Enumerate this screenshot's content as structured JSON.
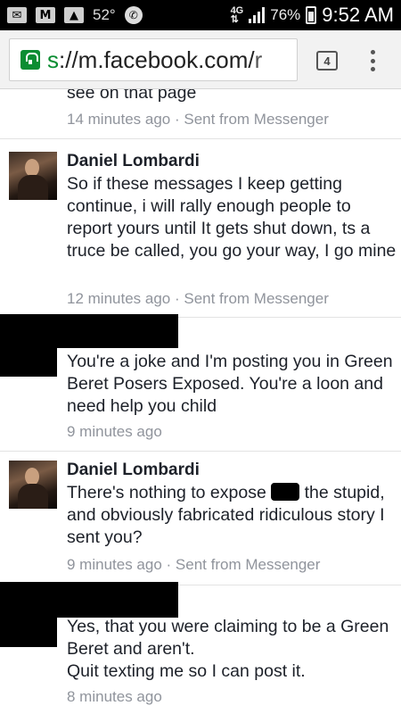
{
  "status_bar": {
    "icons": [
      "mail-icon",
      "gmail-icon",
      "gallery-icon"
    ],
    "temperature": "52°",
    "network": "4G LTE",
    "battery_percent": "76%",
    "battery_level": 0.76,
    "time": "9:52 AM"
  },
  "browser": {
    "url_scheme": "s",
    "url_main": "://m.facebook.com/",
    "url_tail": "r",
    "tab_count": "4"
  },
  "messages": [
    {
      "sender": "",
      "text": "see on that page",
      "time": "14 minutes ago",
      "source": "Sent from Messenger"
    },
    {
      "sender": "Daniel Lombardi",
      "text": "So if these messages I keep getting continue, i will rally enough people to report yours until It gets shut down, ts a truce be called, you go your way, I go mine",
      "time": "12 minutes ago",
      "source": "Sent from Messenger"
    },
    {
      "sender": "",
      "text": "You're a joke and I'm posting you in Green Beret Posers Exposed. You're a loon and need help you child",
      "time": "9 minutes ago",
      "source": ""
    },
    {
      "sender": "Daniel Lombardi",
      "text_before": "There's nothing to expose",
      "text_after": "the stupid, and obviously fabricated ridiculous story I sent you?",
      "time": "9 minutes ago",
      "source": "Sent from Messenger"
    },
    {
      "sender": "",
      "text_line1": "Yes, that you were claiming to be a Green Beret and aren't.",
      "text_line2": "Quit texting me so I can post it.",
      "time": "8 minutes ago",
      "source": ""
    }
  ],
  "separator": " · "
}
